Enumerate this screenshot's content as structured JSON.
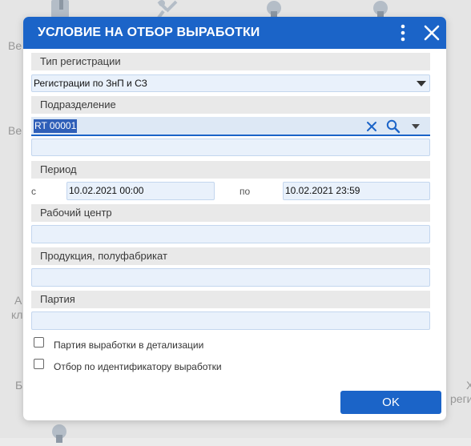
{
  "background": {
    "fragments": [
      "Ве",
      "Ве",
      "А",
      "кл",
      "Б",
      "Х",
      "реги"
    ]
  },
  "dialog": {
    "title": "УСЛОВИЕ НА ОТБОР ВЫРАБОТКИ",
    "sections": {
      "registration_type": "Тип регистрации",
      "subdivision": "Подразделение",
      "period": "Период",
      "work_center": "Рабочий центр",
      "product": "Продукция, полуфабрикат",
      "batch": "Партия"
    },
    "registration_type_value": "Регистрации по ЗнП и СЗ",
    "subdivision_value": "RT 00001",
    "subdivision_extra_value": "",
    "period": {
      "from_label": "с",
      "from_value": "10.02.2021 00:00",
      "to_label": "по",
      "to_value": "10.02.2021 23:59"
    },
    "work_center_value": "",
    "product_value": "",
    "batch_value": "",
    "checkboxes": [
      {
        "label": "Партия выработки в детализации",
        "checked": false
      },
      {
        "label": "Отбор по идентификатору выработки",
        "checked": false
      }
    ],
    "ok_label": "OK"
  },
  "colors": {
    "accent": "#1b64c8",
    "section_bg": "#e9e9e9",
    "field_bg": "#e9f1fb"
  },
  "icons": [
    "kebab-menu-icon",
    "close-icon",
    "clear-icon",
    "search-icon",
    "chevron-down-icon"
  ]
}
